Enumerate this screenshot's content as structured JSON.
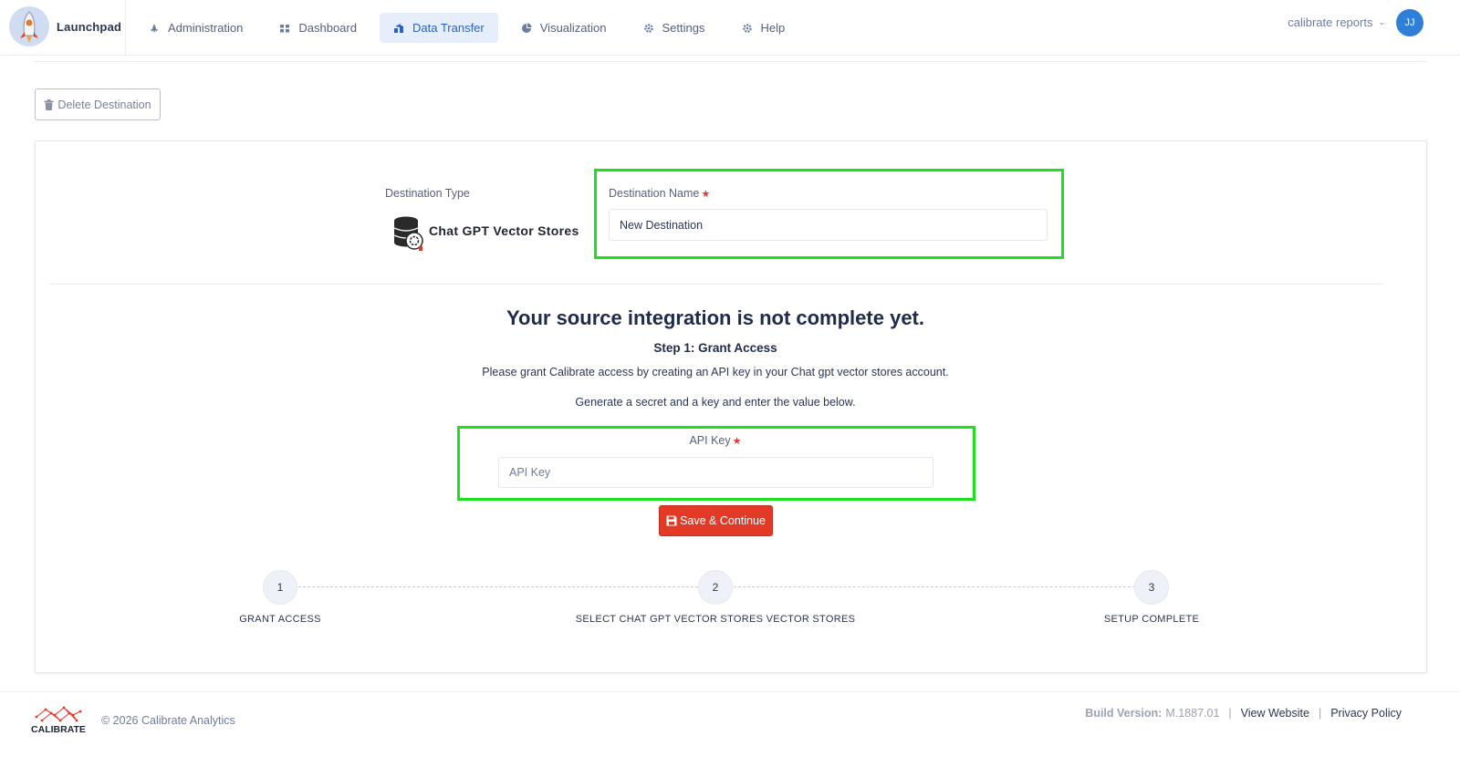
{
  "header": {
    "brand": "Launchpad",
    "nav": [
      {
        "label": "Administration",
        "icon": "rocket-icon"
      },
      {
        "label": "Dashboard",
        "icon": "grid-icon"
      },
      {
        "label": "Data Transfer",
        "icon": "transfer-icon",
        "active": true
      },
      {
        "label": "Visualization",
        "icon": "pie-icon"
      },
      {
        "label": "Settings",
        "icon": "gear-icon"
      },
      {
        "label": "Help",
        "icon": "gear-icon"
      }
    ],
    "account_name": "calibrate reports",
    "avatar_initials": "JJ"
  },
  "actions": {
    "delete_label": "Delete Destination"
  },
  "destination": {
    "type_label": "Destination Type",
    "type_name": "Chat GPT Vector Stores",
    "name_label": "Destination Name",
    "name_value": "New Destination"
  },
  "integration": {
    "heading": "Your source integration is not complete yet.",
    "step_title": "Step 1: Grant Access",
    "paragraph1": "Please grant Calibrate access by creating an API key in your Chat gpt vector stores account.",
    "paragraph2": "Generate a secret and a key and enter the value below.",
    "api_label": "API Key",
    "api_placeholder": "API Key",
    "save_label": "Save & Continue"
  },
  "stepper": {
    "steps": [
      {
        "number": "1",
        "label": "GRANT ACCESS"
      },
      {
        "number": "2",
        "label": "SELECT CHAT GPT VECTOR STORES VECTOR STORES"
      },
      {
        "number": "3",
        "label": "SETUP COMPLETE"
      }
    ]
  },
  "footer": {
    "logo_text": "CALIBRATE",
    "copyright": "© 2026 Calibrate Analytics",
    "build_label": "Build Version:",
    "build_value": "M.1887.01",
    "view_website": "View Website",
    "privacy_policy": "Privacy Policy"
  },
  "colors": {
    "accent": "#2862c9",
    "save_button": "#e23a26",
    "highlight": "#1ee01e",
    "avatar": "#2f7ed8"
  }
}
